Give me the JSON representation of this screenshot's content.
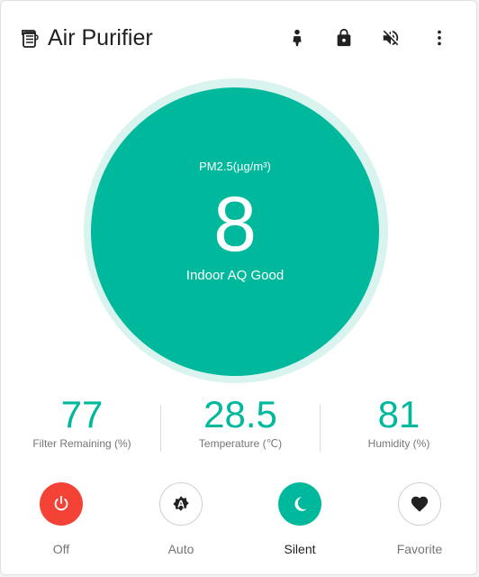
{
  "header": {
    "title": "Air Purifier",
    "icons": [
      "air-filter-icon",
      "child-lock-icon",
      "lock-icon",
      "volume-off-icon",
      "more-vert-icon"
    ]
  },
  "dial": {
    "label": "PM2.5(µg/m³)",
    "value": "8",
    "status": "Indoor AQ Good"
  },
  "stats": [
    {
      "value": "77",
      "caption": "Filter Remaining (%)"
    },
    {
      "value": "28.5",
      "caption": "Temperature (℃)"
    },
    {
      "value": "81",
      "caption": "Humidity (%)"
    }
  ],
  "modes": [
    {
      "label": "Off",
      "icon": "power-icon"
    },
    {
      "label": "Auto",
      "icon": "auto-brightness-icon"
    },
    {
      "label": "Silent",
      "icon": "moon-icon",
      "active": true
    },
    {
      "label": "Favorite",
      "icon": "heart-icon"
    }
  ],
  "colors": {
    "accent": "#00b99d",
    "halo": "#d9f3ee",
    "off_button": "#f44336",
    "text": "#212121",
    "muted": "#757575"
  }
}
